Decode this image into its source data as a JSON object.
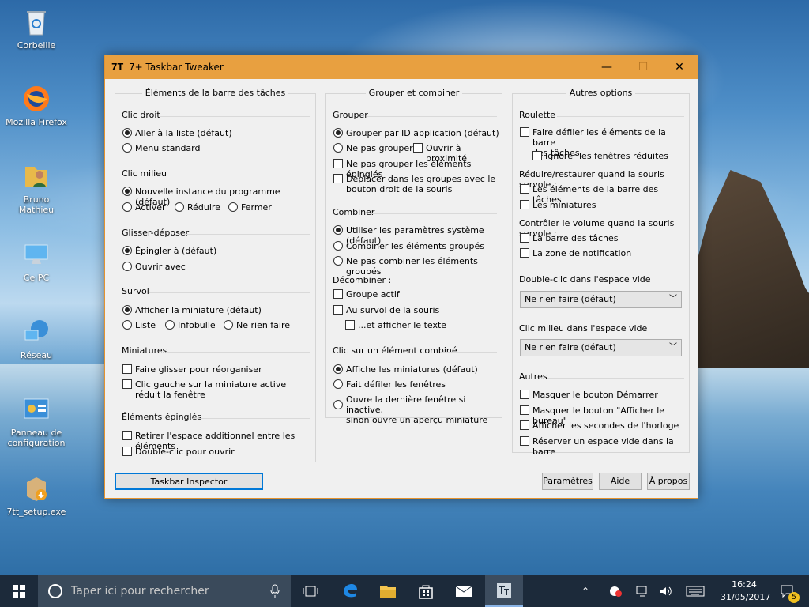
{
  "desktop": {
    "icons": [
      {
        "label": "Corbeille",
        "icon": "recycle-bin-icon"
      },
      {
        "label": "Mozilla Firefox",
        "icon": "firefox-icon"
      },
      {
        "label": "Bruno Mathieu",
        "icon": "user-folder-icon"
      },
      {
        "label": "Ce PC",
        "icon": "computer-icon"
      },
      {
        "label": "Réseau",
        "icon": "network-icon"
      },
      {
        "label": "Panneau de configuration",
        "icon": "control-panel-icon"
      },
      {
        "label": "7tt_setup.exe",
        "icon": "installer-icon"
      }
    ]
  },
  "window": {
    "title": "7+ Taskbar Tweaker",
    "app_icon_text": "7T",
    "minimize": "—",
    "maximize": "☐",
    "close": "✕"
  },
  "left": {
    "title": "Éléments de la barre des tâches",
    "clic_droit": {
      "label": "Clic droit",
      "opt1": "Aller à la liste (défaut)",
      "opt2": "Menu standard"
    },
    "clic_milieu": {
      "label": "Clic milieu",
      "opt1": "Nouvelle instance du programme (défaut)",
      "opt2": "Activer",
      "opt3": "Réduire",
      "opt4": "Fermer"
    },
    "glisser": {
      "label": "Glisser-déposer",
      "opt1": "Épingler à (défaut)",
      "opt2": "Ouvrir avec"
    },
    "survol": {
      "label": "Survol",
      "opt1": "Afficher la miniature (défaut)",
      "opt2": "Liste",
      "opt3": "Infobulle",
      "opt4": "Ne rien faire"
    },
    "miniatures": {
      "label": "Miniatures",
      "opt1": "Faire glisser pour réorganiser",
      "opt2": "Clic gauche sur la miniature active",
      "opt2b": "réduit la fenêtre"
    },
    "epingles": {
      "label": "Éléments épinglés",
      "opt1": "Retirer l'espace additionnel entre les éléments",
      "opt2": "Double-clic pour ouvrir"
    }
  },
  "middle": {
    "title": "Grouper et combiner",
    "grouper": {
      "label": "Grouper",
      "opt1": "Grouper par ID application (défaut)",
      "opt2": "Ne pas grouper",
      "opt3": "Ouvrir à proximité",
      "opt4": "Ne pas grouper les éléments épinglés",
      "opt5": "Déplacer dans les groupes avec le",
      "opt5b": "bouton droit de la souris"
    },
    "combiner": {
      "label": "Combiner",
      "opt1": "Utiliser les paramètres système (défaut)",
      "opt2": "Combiner les éléments groupés",
      "opt3": "Ne pas combiner les éléments groupés"
    },
    "decombiner": {
      "label": "Décombiner :",
      "opt1": "Groupe actif",
      "opt2": "Au survol de la souris",
      "opt3": "...et afficher le texte"
    },
    "clic_combine": {
      "label": "Clic sur un élément combiné",
      "opt1": "Affiche les miniatures (défaut)",
      "opt2": "Fait défiler les fenêtres",
      "opt3": "Ouvre la dernière fenêtre si inactive,",
      "opt3b": "sinon ouvre un aperçu miniature"
    }
  },
  "right": {
    "title": "Autres options",
    "roulette": {
      "label": "Roulette",
      "opt1": "Faire défiler les éléments de la barre",
      "opt1b": "des tâches",
      "opt2": "Ignorer les fenêtres réduites"
    },
    "reduire": {
      "label": "Réduire/restaurer quand la souris survole :",
      "opt1": "Les éléments de la barre des tâches",
      "opt2": "Les miniatures"
    },
    "volume": {
      "label": "Contrôler le volume quand la souris survole :",
      "opt1": "La barre des tâches",
      "opt2": "La zone de notification"
    },
    "double_clic": {
      "label": "Double-clic dans l'espace vide",
      "value": "Ne rien faire (défaut)"
    },
    "clic_milieu_vide": {
      "label": "Clic milieu dans l'espace vide",
      "value": "Ne rien faire (défaut)"
    },
    "autres": {
      "label": "Autres",
      "opt1": "Masquer le bouton Démarrer",
      "opt2": "Masquer le bouton \"Afficher le bureau\"",
      "opt3": "Afficher les secondes de l'horloge",
      "opt4": "Réserver un espace vide dans la barre"
    }
  },
  "buttons": {
    "inspector": "Taskbar Inspector",
    "parametres": "Paramètres",
    "aide": "Aide",
    "apropos": "À propos"
  },
  "taskbar": {
    "search_placeholder": "Taper ici pour rechercher",
    "time": "16:24",
    "date": "31/05/2017",
    "notif_count": "5"
  }
}
